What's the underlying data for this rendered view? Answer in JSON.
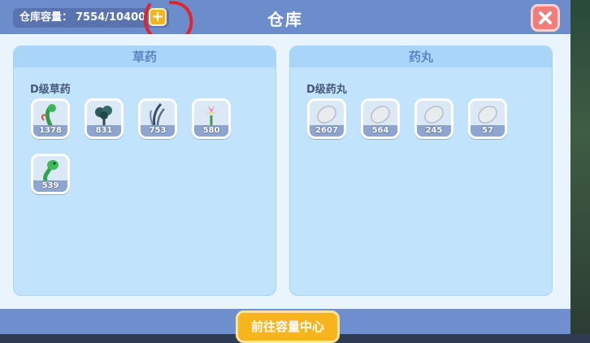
{
  "header": {
    "capacity_label": "仓库容量：",
    "capacity_value": "7554/10400",
    "title": "仓库"
  },
  "panels": [
    {
      "title": "草药",
      "section": "D级草药",
      "items": [
        {
          "icon": "herb-red-vine-icon",
          "count": "1378"
        },
        {
          "icon": "herb-dark-bush-icon",
          "count": "831"
        },
        {
          "icon": "herb-grass-blades-icon",
          "count": "753"
        },
        {
          "icon": "herb-pink-lily-icon",
          "count": "580"
        },
        {
          "icon": "herb-green-creature-icon",
          "count": "539"
        }
      ]
    },
    {
      "title": "药丸",
      "section": "D级药丸",
      "items": [
        {
          "icon": "pill-icon",
          "count": "2607"
        },
        {
          "icon": "pill-icon",
          "count": "564"
        },
        {
          "icon": "pill-icon",
          "count": "245"
        },
        {
          "icon": "pill-icon",
          "count": "57"
        }
      ]
    }
  ],
  "footer": {
    "button_label": "前往容量中心"
  },
  "colors": {
    "accent_orange": "#f8b41f",
    "close_red": "#ef7e7b",
    "window_blue": "#6f8fcf",
    "annotation_red": "#e0262c"
  }
}
